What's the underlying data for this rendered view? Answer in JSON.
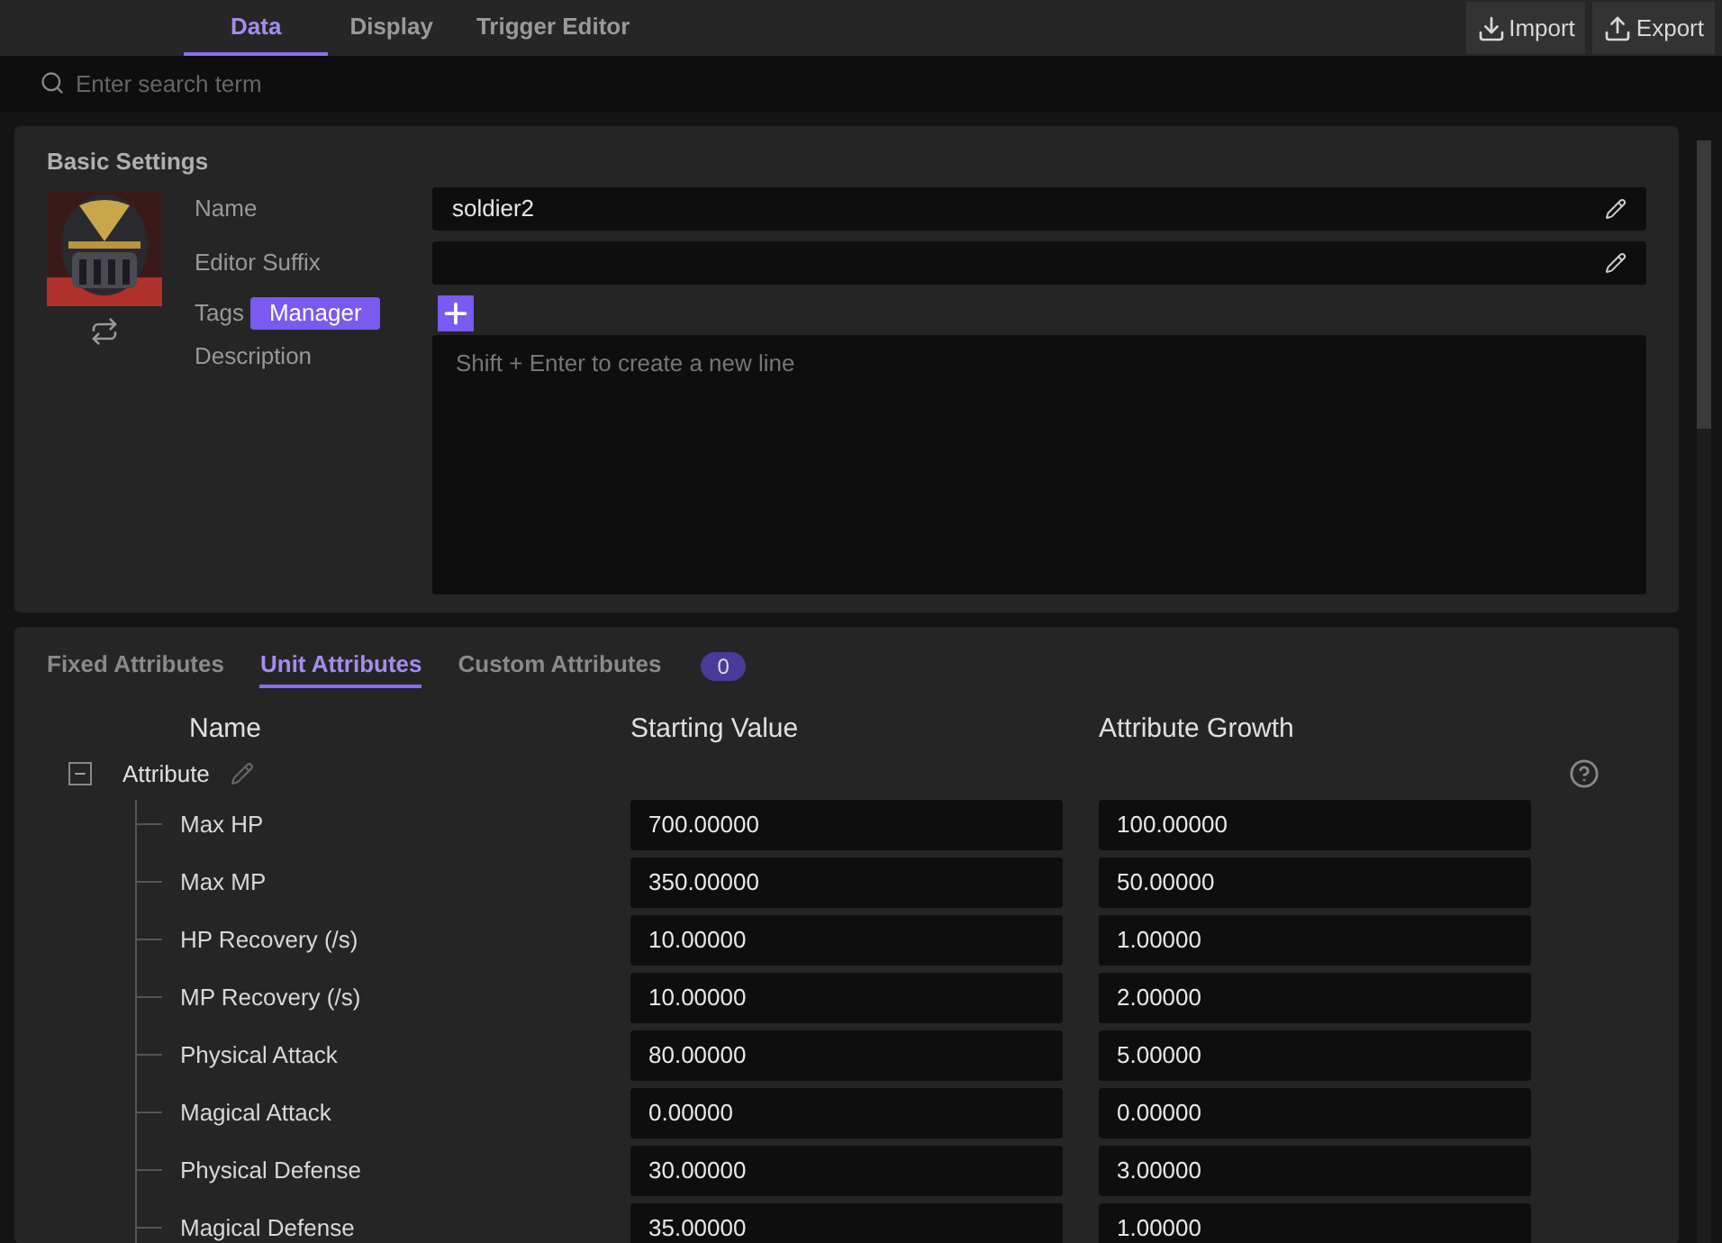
{
  "top_tabs": [
    {
      "label": "Data",
      "selected": true
    },
    {
      "label": "Display",
      "selected": false
    },
    {
      "label": "Trigger Editor",
      "selected": false
    }
  ],
  "actions": [
    "Import",
    "Export"
  ],
  "search": {
    "placeholder": "Enter search term"
  },
  "basic_settings": {
    "title": "Basic Settings",
    "name_label": "Name",
    "name_value": "soldier2",
    "suffix_label": "Editor Suffix",
    "tags_label": "Tags",
    "tags": [
      "Manager"
    ],
    "description_label": "Description",
    "description_placeholder": "Shift + Enter to create a new line"
  },
  "attribute_tabs": [
    {
      "label": "Fixed Attributes",
      "selected": false
    },
    {
      "label": "Unit Attributes",
      "selected": true
    },
    {
      "label": "Custom Attributes",
      "selected": false,
      "count": "0"
    }
  ],
  "table": {
    "columns": [
      "Name",
      "Starting Value",
      "Attribute Growth"
    ],
    "group": {
      "name": "Attribute",
      "expanded": true,
      "children": [
        {
          "name": "Max HP",
          "start": "700.00000",
          "growth": "100.00000"
        },
        {
          "name": "Max MP",
          "start": "350.00000",
          "growth": "50.00000"
        },
        {
          "name": "HP Recovery (/s)",
          "start": "10.00000",
          "growth": "1.00000"
        },
        {
          "name": "MP Recovery (/s)",
          "start": "10.00000",
          "growth": "2.00000"
        },
        {
          "name": "Physical Attack",
          "start": "80.00000",
          "growth": "5.00000"
        },
        {
          "name": "Magical Attack",
          "start": "0.00000",
          "growth": "0.00000"
        },
        {
          "name": "Physical Defense",
          "start": "30.00000",
          "growth": "3.00000"
        },
        {
          "name": "Magical Defense",
          "start": "35.00000",
          "growth": "1.00000"
        }
      ]
    }
  }
}
